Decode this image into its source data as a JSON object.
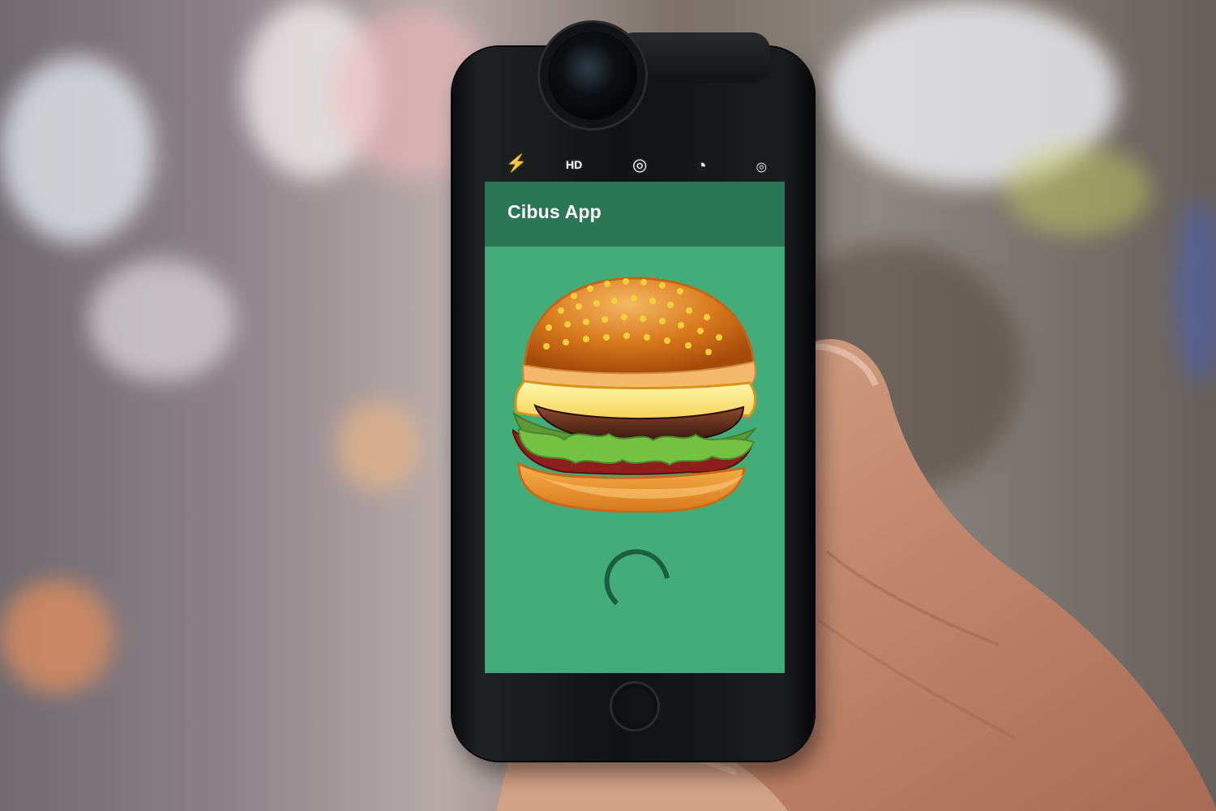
{
  "app": {
    "title": "Cibus App"
  },
  "camera_controls": {
    "items": [
      {
        "name": "flash-off",
        "icon": "flash-off-icon"
      },
      {
        "name": "hdr",
        "icon": "hdr-icon"
      },
      {
        "name": "live-photo",
        "icon": "live-photo-icon"
      },
      {
        "name": "timer",
        "icon": "timer-icon"
      },
      {
        "name": "switch-camera",
        "icon": "camera-switch-icon"
      }
    ]
  },
  "content": {
    "image_icon": "burger-illustration",
    "loading_icon": "loading-spinner-icon"
  },
  "colors": {
    "app_background": "#43ad79",
    "app_bar": "#2b7656",
    "spinner": "#1c5e40",
    "text": "#ffffff"
  }
}
